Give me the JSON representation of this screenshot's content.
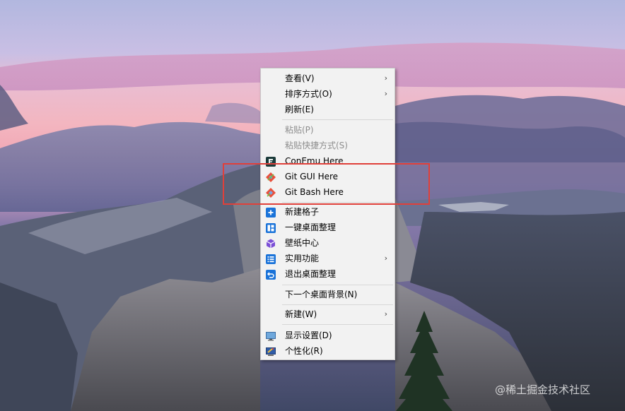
{
  "menu": {
    "items": [
      {
        "label": "查看(V)",
        "arrow": "›"
      },
      {
        "label": "排序方式(O)",
        "arrow": "›"
      },
      {
        "label": "刷新(E)"
      },
      {
        "label": "粘贴(P)",
        "disabled": true
      },
      {
        "label": "粘贴快捷方式(S)",
        "disabled": true
      },
      {
        "label": "ConEmu Here",
        "icon": "conemu-icon"
      },
      {
        "label": "Git GUI Here",
        "icon": "git-gui-icon"
      },
      {
        "label": "Git Bash Here",
        "icon": "git-bash-icon"
      },
      {
        "label": "新建格子",
        "icon": "add-box-icon"
      },
      {
        "label": "一键桌面整理",
        "icon": "grid-layout-icon"
      },
      {
        "label": "壁纸中心",
        "icon": "cube-icon"
      },
      {
        "label": "实用功能",
        "icon": "list-icon",
        "arrow": "›"
      },
      {
        "label": "退出桌面整理",
        "icon": "exit-icon"
      },
      {
        "label": "下一个桌面背景(N)"
      },
      {
        "label": "新建(W)",
        "arrow": "›"
      },
      {
        "label": "显示设置(D)",
        "icon": "monitor-icon"
      },
      {
        "label": "个性化(R)",
        "icon": "personalize-icon"
      }
    ]
  },
  "watermark": "@稀土掘金技术社区",
  "colors": {
    "accent_blue": "#1a73d9",
    "highlight_border": "#e0403a",
    "menu_bg": "#f2f2f2"
  }
}
